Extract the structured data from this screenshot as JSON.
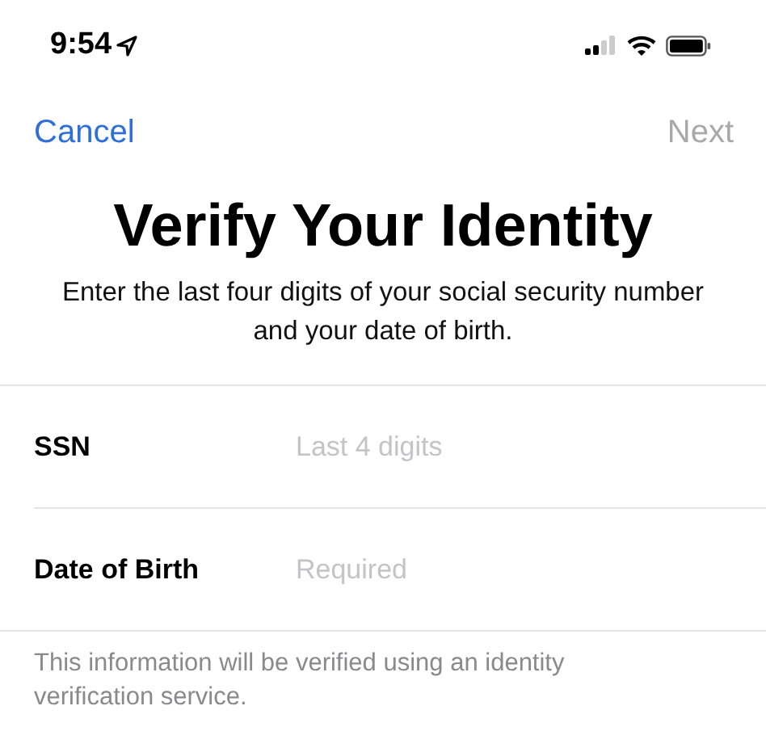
{
  "status_bar": {
    "time": "9:54"
  },
  "nav": {
    "cancel": {
      "label": "Cancel",
      "disabled": false
    },
    "next": {
      "label": "Next",
      "disabled": true
    }
  },
  "title": "Verify Your Identity",
  "subtitle": "Enter the last four digits of your social security number and your date of birth.",
  "fields": [
    {
      "label": "SSN",
      "placeholder": "Last 4 digits"
    },
    {
      "label": "Date of Birth",
      "placeholder": "Required"
    }
  ],
  "footer": "This information will be verified using an identity verification service."
}
